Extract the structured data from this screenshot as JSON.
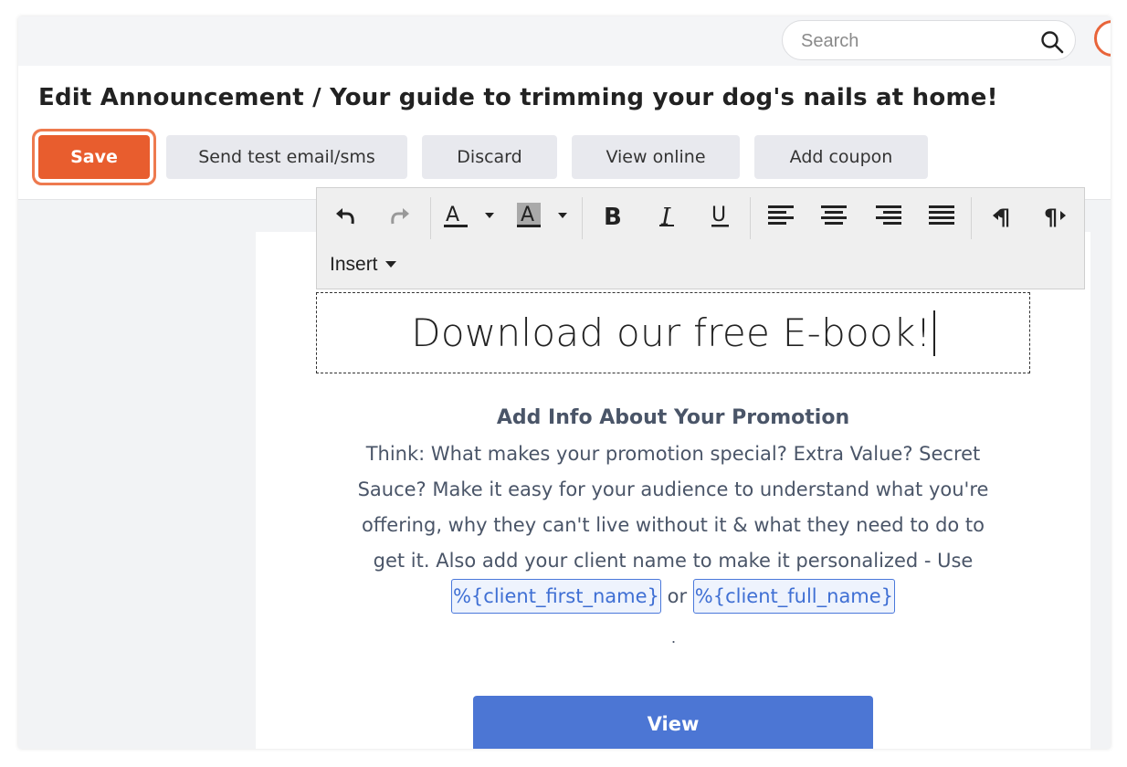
{
  "search": {
    "placeholder": "Search"
  },
  "header": {
    "title": "Edit Announcement / Your guide to trimming your dog's nails at home!"
  },
  "actions": {
    "save": "Save",
    "send_test": "Send test email/sms",
    "discard": "Discard",
    "view_online": "View online",
    "add_coupon": "Add coupon"
  },
  "toolbar": {
    "insert_label": "Insert",
    "icons": [
      "undo-icon",
      "redo-icon",
      "font-color-icon",
      "background-color-icon",
      "bold-icon",
      "italic-icon",
      "underline-icon",
      "align-left-icon",
      "align-center-icon",
      "align-right-icon",
      "align-justify-icon",
      "ltr-icon",
      "rtl-icon"
    ]
  },
  "email": {
    "headline": "Download our free E-book!",
    "promo_title": "Add Info About Your Promotion",
    "promo_body": "Think: What makes your promotion special? Extra Value? Secret Sauce? Make it easy for your audience to understand what you're offering, why they can't live without it & what they need to do to get it. Also add your client name to make it personalized - Use",
    "token_first": "%{client_first_name}",
    "connector": "or",
    "token_full": "%{client_full_name}",
    "trailing": ".",
    "view_button": "View"
  },
  "colors": {
    "accent": "#e85d2e",
    "primary_blue": "#4c76d4",
    "token_blue": "#3f6fd4"
  }
}
